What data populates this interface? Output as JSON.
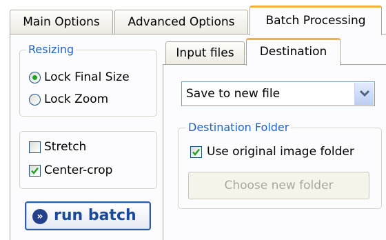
{
  "main_tabs": [
    {
      "label": "Main Options",
      "active": false
    },
    {
      "label": "Advanced Options",
      "active": false
    },
    {
      "label": "Batch Processing",
      "active": true
    }
  ],
  "resizing": {
    "title": "Resizing",
    "options": [
      {
        "label": "Lock Final Size",
        "selected": true
      },
      {
        "label": "Lock Zoom",
        "selected": false
      }
    ]
  },
  "crop_options": [
    {
      "label": "Stretch",
      "checked": false
    },
    {
      "label": "Center-crop",
      "checked": true
    }
  ],
  "run_button": {
    "label": "run batch",
    "icon": "double-chevron-right-icon"
  },
  "sub_tabs": [
    {
      "label": "Input files",
      "active": false
    },
    {
      "label": "Destination",
      "active": true
    }
  ],
  "destination": {
    "save_mode": "Save to new file",
    "folder_group": {
      "title": "Destination Folder",
      "use_original_label": "Use original image folder",
      "use_original_checked": true,
      "choose_button_label": "Choose new folder",
      "choose_button_enabled": false
    }
  },
  "colors": {
    "group_title": "#2161c4",
    "active_tab_accent": "#f3b23a",
    "check_mark": "#21a121",
    "run_button_text": "#1b4a9c"
  }
}
